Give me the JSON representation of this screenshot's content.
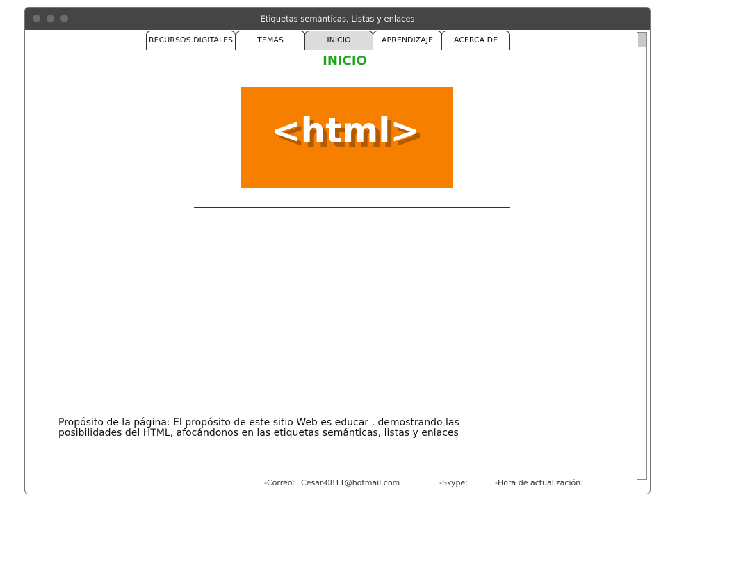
{
  "window": {
    "title": "Etiquetas semánticas, Listas y enlaces"
  },
  "nav": {
    "tabs": [
      {
        "label": "RECURSOS DIGITALES",
        "active": false
      },
      {
        "label": "TEMAS",
        "active": false
      },
      {
        "label": "INICIO",
        "active": true
      },
      {
        "label": "APRENDIZAJE",
        "active": false
      },
      {
        "label": "ACERCA DE",
        "active": false
      }
    ]
  },
  "main": {
    "heading": "INICIO",
    "banner": {
      "text": "<html>",
      "background": "#f77f00"
    },
    "purpose": "Propósito de la página: El propósito de este sitio Web es  educar , demostrando las posibilidades del HTML, afocándonos en las etiquetas semánticas, listas y enlaces"
  },
  "footer": {
    "email_label": "-Correo:",
    "email_value": "Cesar-0811@hotmail.com",
    "skype_label": "-Skype:",
    "update_label": "-Hora de actualización:"
  },
  "colors": {
    "heading": "#1aa81a",
    "titlebar": "#454545",
    "active_tab": "#dcdcdc"
  }
}
